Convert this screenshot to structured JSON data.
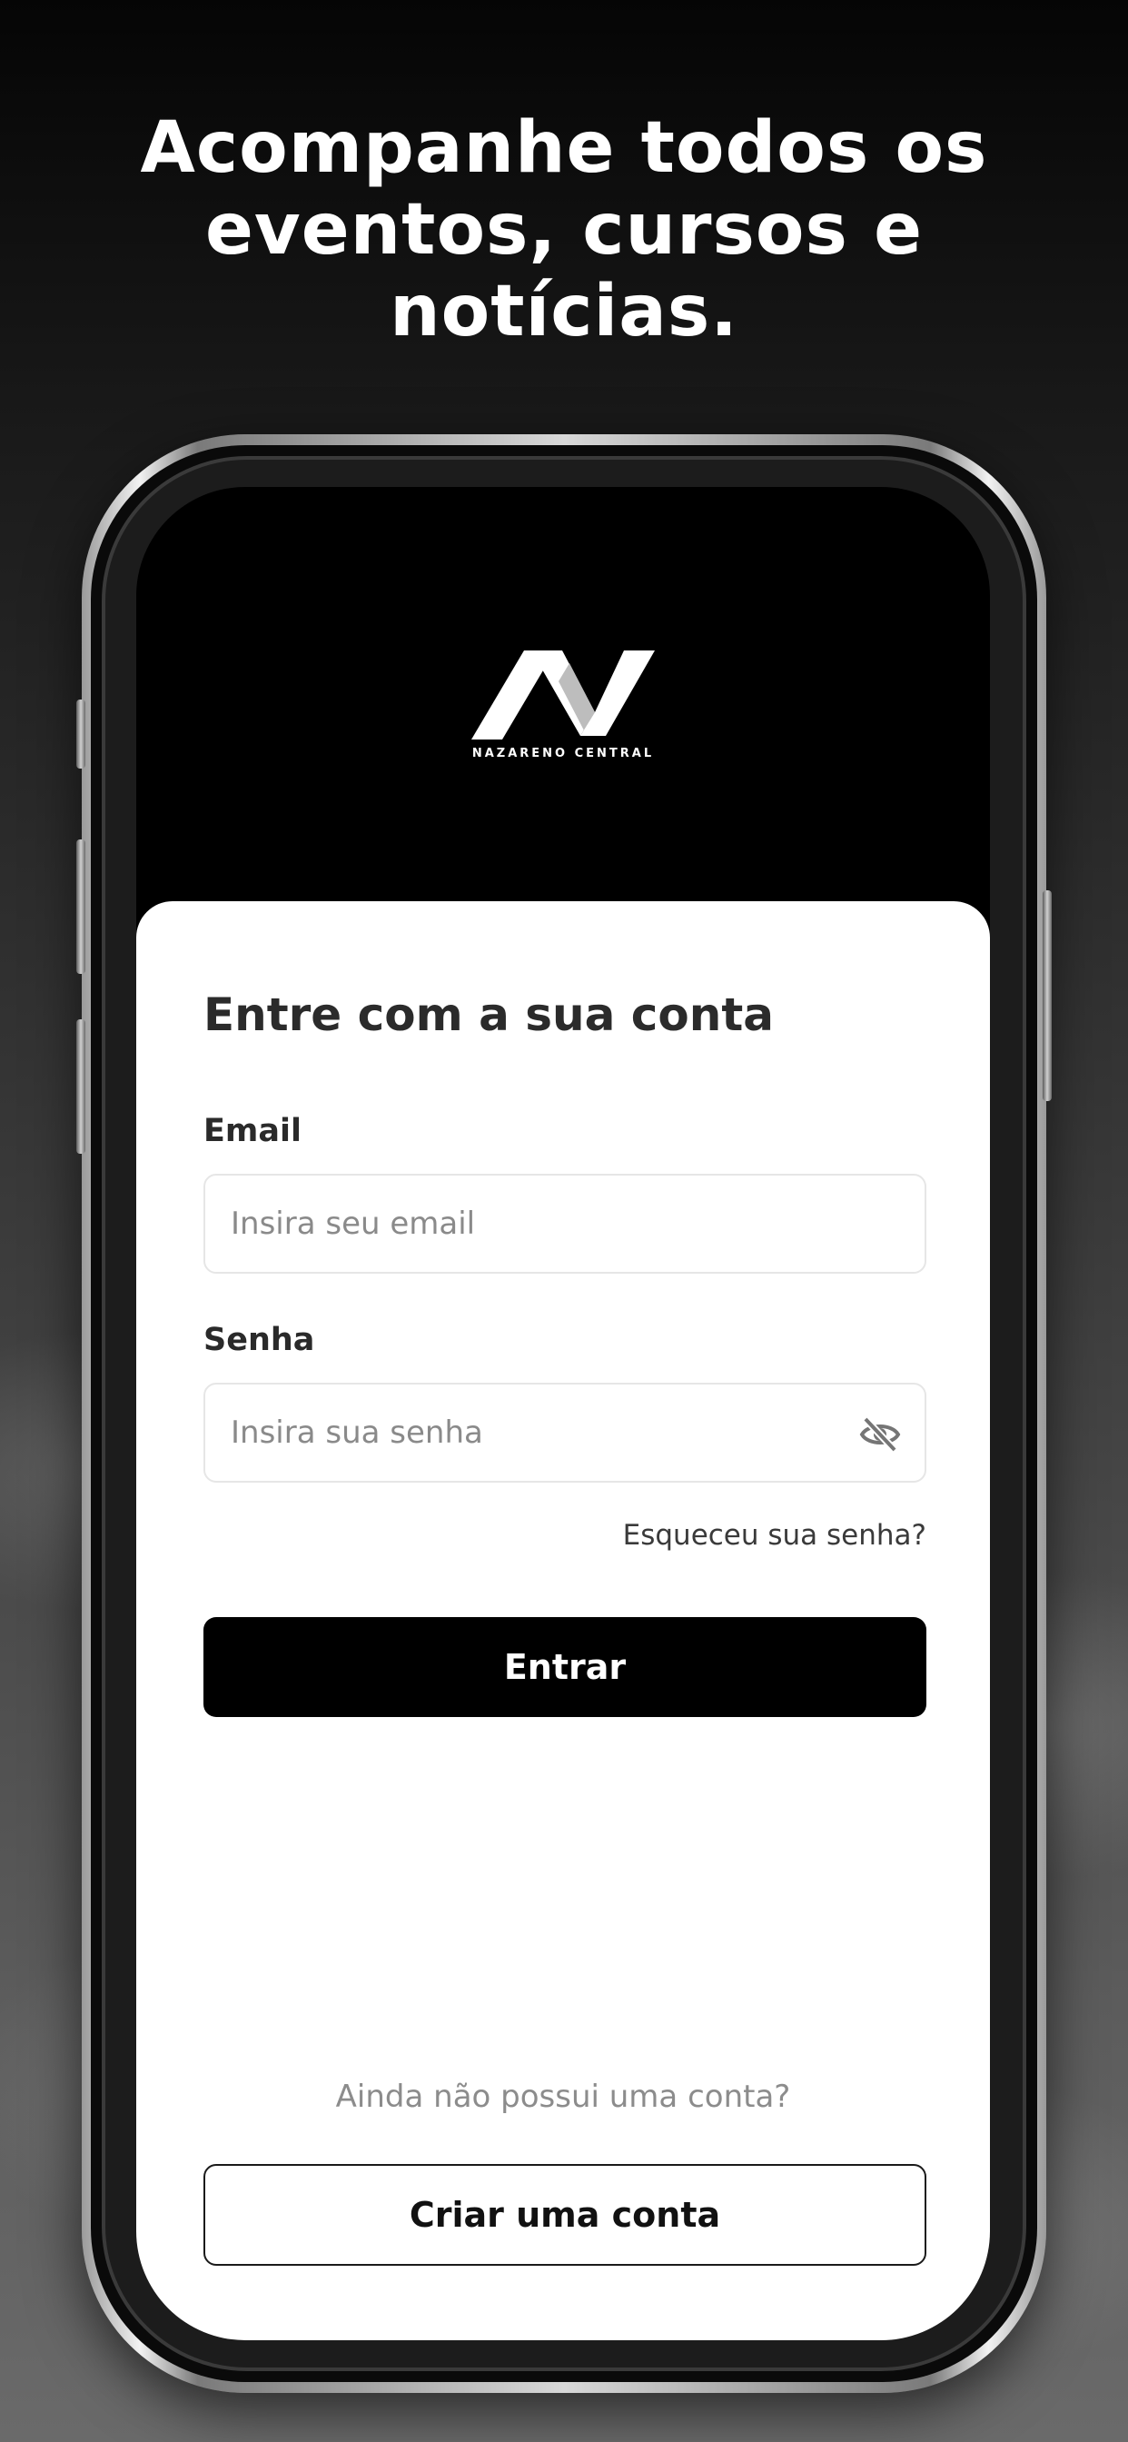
{
  "headline": {
    "line1": "Acompanhe todos os",
    "line2": "eventos, cursos e",
    "line3": "notícias."
  },
  "brand": {
    "logo_text": "NAZARENO CENTRAL",
    "logo_icon": "nazareno-n-logo-icon"
  },
  "login": {
    "title": "Entre com a sua conta",
    "email_label": "Email",
    "email_placeholder": "Insira seu email",
    "password_label": "Senha",
    "password_placeholder": "Insira sua senha",
    "password_toggle_icon": "eye-off-icon",
    "forgot_label": "Esqueceu sua senha?",
    "submit_label": "Entrar",
    "no_account_text": "Ainda não possui uma conta?",
    "create_account_label": "Criar uma conta"
  },
  "colors": {
    "primary_button": "#000000",
    "card_background": "#ffffff",
    "headline_text": "#ffffff"
  }
}
